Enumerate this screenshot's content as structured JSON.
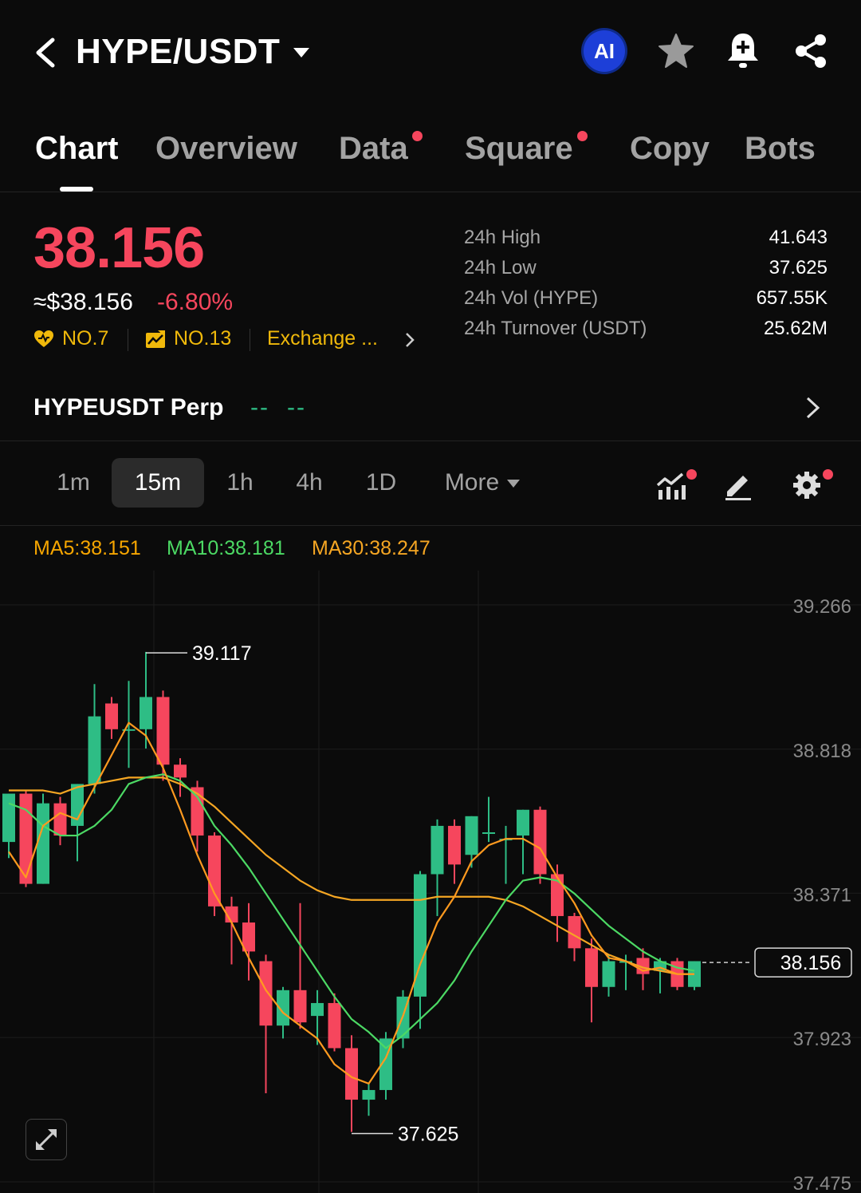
{
  "header": {
    "pair": "HYPE/USDT",
    "ai_label": "AI",
    "icons": [
      "back-icon",
      "caret-down-icon",
      "ai-icon",
      "star-icon",
      "bell-plus-icon",
      "share-icon"
    ]
  },
  "tabs": [
    {
      "label": "Chart",
      "active": true,
      "dot": false
    },
    {
      "label": "Overview",
      "active": false,
      "dot": false
    },
    {
      "label": "Data",
      "active": false,
      "dot": true
    },
    {
      "label": "Square",
      "active": false,
      "dot": true
    },
    {
      "label": "Copy",
      "active": false,
      "dot": false
    },
    {
      "label": "Bots",
      "active": false,
      "dot": false
    }
  ],
  "price": {
    "last": "38.156",
    "approx": "≈$38.156",
    "change": "-6.80%",
    "ranks": [
      {
        "icon": "heart-icon",
        "label": "NO.7"
      },
      {
        "icon": "chart-up-icon",
        "label": "NO.13"
      },
      {
        "icon": "",
        "label": "Exchange ..."
      }
    ]
  },
  "stats": [
    {
      "label": "24h High",
      "value": "41.643"
    },
    {
      "label": "24h Low",
      "value": "37.625"
    },
    {
      "label": "24h Vol (HYPE)",
      "value": "657.55K"
    },
    {
      "label": "24h Turnover (USDT)",
      "value": "25.62M"
    }
  ],
  "perp": {
    "name": "HYPEUSDT Perp",
    "price": "--",
    "change": "--"
  },
  "intervals": [
    {
      "label": "1m",
      "active": false
    },
    {
      "label": "15m",
      "active": true
    },
    {
      "label": "1h",
      "active": false
    },
    {
      "label": "4h",
      "active": false
    },
    {
      "label": "1D",
      "active": false
    },
    {
      "label": "More",
      "active": false
    }
  ],
  "tools": [
    "indicators-icon",
    "draw-pencil-icon",
    "settings-gear-icon"
  ],
  "ma": {
    "ma5": "MA5:38.151",
    "ma10": "MA10:38.181",
    "ma30": "MA30:38.247"
  },
  "colors": {
    "up": "#2ebd85",
    "down": "#f6465d",
    "ma5": "#f7a600",
    "ma10": "#4cd964",
    "ma30": "#f5a623",
    "accent": "#f0b90b"
  },
  "chart_data": {
    "type": "candlestick",
    "y_axis_labels": [
      "39.266",
      "38.818",
      "38.371",
      "37.923",
      "37.475"
    ],
    "ylim": [
      37.475,
      39.266
    ],
    "high_marker": "39.117",
    "low_marker": "37.625",
    "last_price_tag": "38.156",
    "candles": [
      {
        "o": 38.53,
        "h": 38.63,
        "l": 38.48,
        "c": 38.68
      },
      {
        "o": 38.68,
        "h": 38.69,
        "l": 38.39,
        "c": 38.4
      },
      {
        "o": 38.4,
        "h": 38.68,
        "l": 38.4,
        "c": 38.65
      },
      {
        "o": 38.65,
        "h": 38.67,
        "l": 38.52,
        "c": 38.55
      },
      {
        "o": 38.58,
        "h": 38.7,
        "l": 38.47,
        "c": 38.71
      },
      {
        "o": 38.71,
        "h": 39.02,
        "l": 38.68,
        "c": 38.92
      },
      {
        "o": 38.96,
        "h": 38.98,
        "l": 38.85,
        "c": 38.88
      },
      {
        "o": 38.88,
        "h": 39.03,
        "l": 38.76,
        "c": 38.88
      },
      {
        "o": 38.88,
        "h": 39.12,
        "l": 38.82,
        "c": 38.98
      },
      {
        "o": 38.98,
        "h": 39.0,
        "l": 38.72,
        "c": 38.77
      },
      {
        "o": 38.77,
        "h": 38.79,
        "l": 38.67,
        "c": 38.73
      },
      {
        "o": 38.7,
        "h": 38.72,
        "l": 38.5,
        "c": 38.55
      },
      {
        "o": 38.55,
        "h": 38.56,
        "l": 38.3,
        "c": 38.33
      },
      {
        "o": 38.33,
        "h": 38.36,
        "l": 38.15,
        "c": 38.28
      },
      {
        "o": 38.28,
        "h": 38.34,
        "l": 38.1,
        "c": 38.19
      },
      {
        "o": 38.16,
        "h": 38.18,
        "l": 37.75,
        "c": 37.96
      },
      {
        "o": 37.96,
        "h": 38.08,
        "l": 37.92,
        "c": 38.07
      },
      {
        "o": 38.07,
        "h": 38.34,
        "l": 37.95,
        "c": 37.97
      },
      {
        "o": 37.99,
        "h": 38.07,
        "l": 37.9,
        "c": 38.03
      },
      {
        "o": 38.03,
        "h": 38.06,
        "l": 37.88,
        "c": 37.89
      },
      {
        "o": 37.89,
        "h": 37.93,
        "l": 37.63,
        "c": 37.73
      },
      {
        "o": 37.73,
        "h": 37.78,
        "l": 37.68,
        "c": 37.76
      },
      {
        "o": 37.76,
        "h": 37.94,
        "l": 37.73,
        "c": 37.92
      },
      {
        "o": 37.92,
        "h": 38.07,
        "l": 37.89,
        "c": 38.05
      },
      {
        "o": 38.05,
        "h": 38.44,
        "l": 37.95,
        "c": 38.43
      },
      {
        "o": 38.43,
        "h": 38.6,
        "l": 38.3,
        "c": 38.58
      },
      {
        "o": 38.58,
        "h": 38.6,
        "l": 38.4,
        "c": 38.46
      },
      {
        "o": 38.49,
        "h": 38.61,
        "l": 38.45,
        "c": 38.61
      },
      {
        "o": 38.56,
        "h": 38.67,
        "l": 38.53,
        "c": 38.56
      },
      {
        "o": 38.54,
        "h": 38.58,
        "l": 38.4,
        "c": 38.54
      },
      {
        "o": 38.55,
        "h": 38.63,
        "l": 38.43,
        "c": 38.63
      },
      {
        "o": 38.63,
        "h": 38.64,
        "l": 38.4,
        "c": 38.43
      },
      {
        "o": 38.43,
        "h": 38.46,
        "l": 38.22,
        "c": 38.3
      },
      {
        "o": 38.3,
        "h": 38.31,
        "l": 38.16,
        "c": 38.2
      },
      {
        "o": 38.2,
        "h": 38.23,
        "l": 37.97,
        "c": 38.08
      },
      {
        "o": 38.08,
        "h": 38.18,
        "l": 38.05,
        "c": 38.16
      },
      {
        "o": 38.16,
        "h": 38.18,
        "l": 38.07,
        "c": 38.16
      },
      {
        "o": 38.17,
        "h": 38.2,
        "l": 38.07,
        "c": 38.12
      },
      {
        "o": 38.13,
        "h": 38.17,
        "l": 38.06,
        "c": 38.16
      },
      {
        "o": 38.16,
        "h": 38.17,
        "l": 38.07,
        "c": 38.08
      },
      {
        "o": 38.08,
        "h": 38.16,
        "l": 38.07,
        "c": 38.16
      }
    ],
    "ma5": [
      38.5,
      38.42,
      38.58,
      38.62,
      38.6,
      38.7,
      38.8,
      38.9,
      38.86,
      38.76,
      38.63,
      38.49,
      38.37,
      38.28,
      38.17,
      38.07,
      38.0,
      37.96,
      37.92,
      37.84,
      37.8,
      37.78,
      37.86,
      37.99,
      38.15,
      38.28,
      38.36,
      38.47,
      38.52,
      38.54,
      38.54,
      38.51,
      38.42,
      38.34,
      38.24,
      38.17,
      38.16,
      38.13,
      38.14,
      38.12,
      38.12
    ],
    "ma10": [
      38.65,
      38.63,
      38.58,
      38.55,
      38.55,
      38.58,
      38.63,
      38.71,
      38.73,
      38.74,
      38.72,
      38.67,
      38.58,
      38.52,
      38.45,
      38.37,
      38.29,
      38.21,
      38.13,
      38.05,
      37.98,
      37.94,
      37.89,
      37.93,
      37.98,
      38.03,
      38.1,
      38.19,
      38.27,
      38.35,
      38.41,
      38.42,
      38.41,
      38.37,
      38.32,
      38.27,
      38.23,
      38.19,
      38.16,
      38.14,
      38.13
    ],
    "ma30": [
      38.69,
      38.69,
      38.69,
      38.68,
      38.7,
      38.71,
      38.72,
      38.73,
      38.73,
      38.73,
      38.71,
      38.68,
      38.64,
      38.59,
      38.54,
      38.49,
      38.45,
      38.41,
      38.38,
      38.36,
      38.35,
      38.35,
      38.35,
      38.35,
      38.35,
      38.36,
      38.36,
      38.36,
      38.36,
      38.35,
      38.33,
      38.3,
      38.27,
      38.24,
      38.21,
      38.18,
      38.16,
      38.14,
      38.13,
      38.12,
      38.12
    ]
  }
}
